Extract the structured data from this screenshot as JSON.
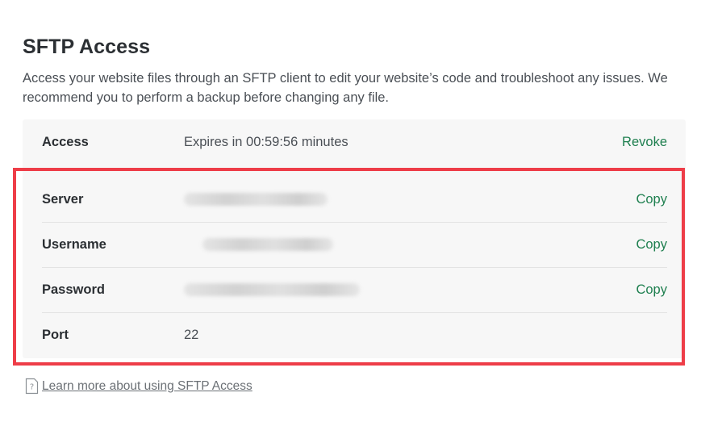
{
  "section": {
    "title": "SFTP Access",
    "description": "Access your website files through an SFTP client to edit your website’s code and troubleshoot any issues. We recommend you to perform a backup before changing any file."
  },
  "rows": {
    "access": {
      "label": "Access",
      "value": "Expires in 00:59:56 minutes",
      "action": "Revoke"
    },
    "server": {
      "label": "Server",
      "action": "Copy"
    },
    "username": {
      "label": "Username",
      "action": "Copy"
    },
    "password": {
      "label": "Password",
      "action": "Copy"
    },
    "port": {
      "label": "Port",
      "value": "22"
    }
  },
  "help": {
    "icon": "question-document-icon",
    "link_text": "Learn more about using SFTP Access"
  },
  "colors": {
    "accent_green": "#1e7f4f",
    "highlight_red": "#ee3d48",
    "card_bg": "#f7f7f7"
  }
}
